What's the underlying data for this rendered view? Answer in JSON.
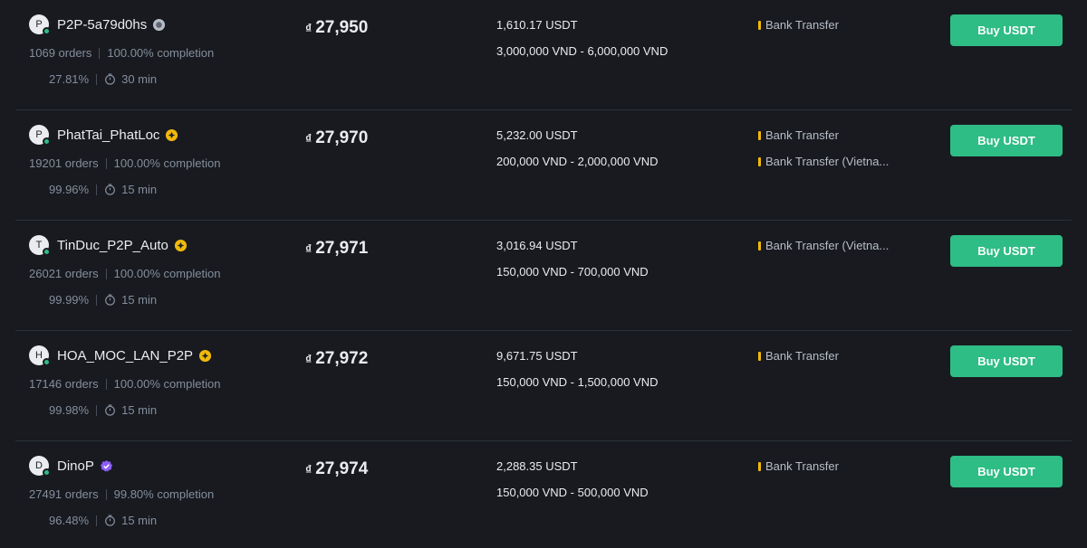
{
  "colors": {
    "background": "#181a20",
    "buy_button": "#2ebd85",
    "payment_marker": "#f0b90b",
    "online": "#2ebd85"
  },
  "ads": [
    {
      "avatar_letter": "P",
      "name": "P2P-5a79d0hs",
      "badge": "gray-verified-badge",
      "orders": "1069 orders",
      "completion": "100.00% completion",
      "rating": "27.81%",
      "pay_time": "30 min",
      "currency_symbol": "₫",
      "price": "27,950",
      "available": "1,610.17 USDT",
      "limit": "3,000,000 VND - 6,000,000 VND",
      "payments": [
        "Bank Transfer"
      ],
      "button": "Buy USDT"
    },
    {
      "avatar_letter": "P",
      "name": "PhatTai_PhatLoc",
      "badge": "gold-merchant-badge",
      "orders": "19201 orders",
      "completion": "100.00% completion",
      "rating": "99.96%",
      "pay_time": "15 min",
      "currency_symbol": "₫",
      "price": "27,970",
      "available": "5,232.00 USDT",
      "limit": "200,000 VND - 2,000,000 VND",
      "payments": [
        "Bank Transfer",
        "Bank Transfer (Vietna..."
      ],
      "button": "Buy USDT"
    },
    {
      "avatar_letter": "T",
      "name": "TinDuc_P2P_Auto",
      "badge": "gold-merchant-badge",
      "orders": "26021 orders",
      "completion": "100.00% completion",
      "rating": "99.99%",
      "pay_time": "15 min",
      "currency_symbol": "₫",
      "price": "27,971",
      "available": "3,016.94 USDT",
      "limit": "150,000 VND - 700,000 VND",
      "payments": [
        "Bank Transfer (Vietna..."
      ],
      "button": "Buy USDT"
    },
    {
      "avatar_letter": "H",
      "name": "HOA_MOC_LAN_P2P",
      "badge": "gold-merchant-badge",
      "orders": "17146 orders",
      "completion": "100.00% completion",
      "rating": "99.98%",
      "pay_time": "15 min",
      "currency_symbol": "₫",
      "price": "27,972",
      "available": "9,671.75 USDT",
      "limit": "150,000 VND - 1,500,000 VND",
      "payments": [
        "Bank Transfer"
      ],
      "button": "Buy USDT"
    },
    {
      "avatar_letter": "D",
      "name": "DinoP",
      "badge": "purple-verified-badge",
      "orders": "27491 orders",
      "completion": "99.80% completion",
      "rating": "96.48%",
      "pay_time": "15 min",
      "currency_symbol": "₫",
      "price": "27,974",
      "available": "2,288.35 USDT",
      "limit": "150,000 VND - 500,000 VND",
      "payments": [
        "Bank Transfer"
      ],
      "button": "Buy USDT"
    }
  ]
}
